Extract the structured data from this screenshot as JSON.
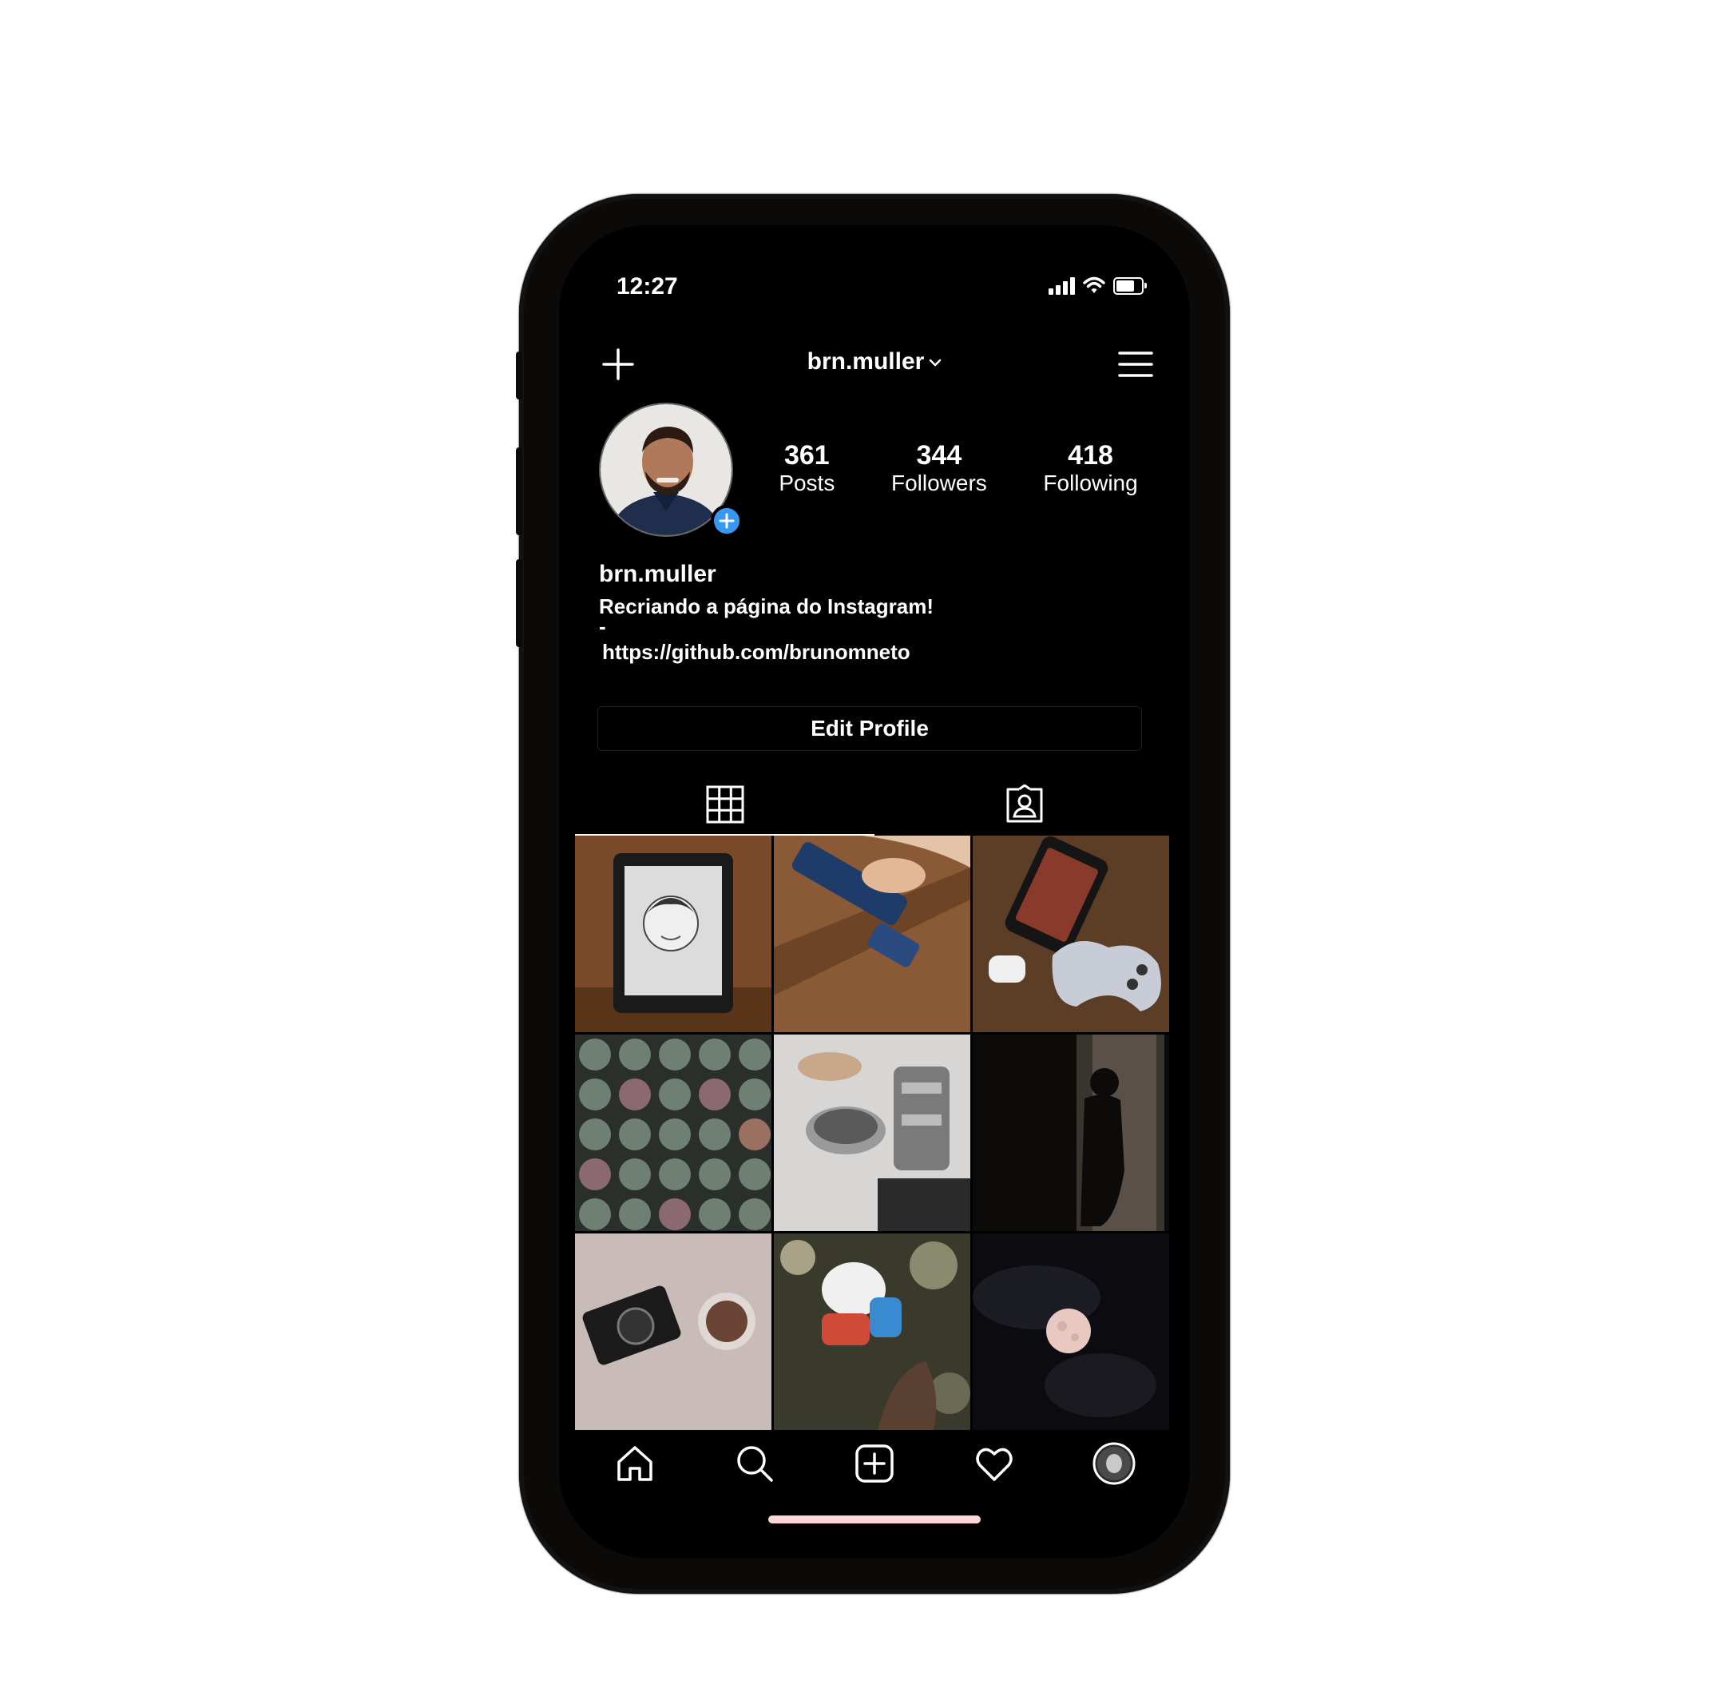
{
  "status_bar": {
    "time": "12:27",
    "icons": [
      "signal-icon",
      "wifi-icon",
      "battery-icon"
    ]
  },
  "header": {
    "username": "brn.muller",
    "left_icon": "plus-icon",
    "right_icon": "menu-icon",
    "dropdown_icon": "chevron-down-icon"
  },
  "profile": {
    "stats": [
      {
        "value": "361",
        "label": "Posts"
      },
      {
        "value": "344",
        "label": "Followers"
      },
      {
        "value": "418",
        "label": "Following"
      }
    ],
    "name": "brn.muller",
    "bio_line": "Recriando a página do Instagram!",
    "bio_dash": "-",
    "link": "https://github.com/brunomneto",
    "edit_button": "Edit Profile",
    "add_story_color": "#3897f0"
  },
  "tabs": [
    {
      "icon": "grid-icon",
      "active": true
    },
    {
      "icon": "tagged-icon",
      "active": false
    }
  ],
  "posts": [
    {
      "subject": "sketch-drawing-photo"
    },
    {
      "subject": "toy-train-photo"
    },
    {
      "subject": "phone-controller-photo"
    },
    {
      "subject": "succulents-photo"
    },
    {
      "subject": "coffee-grinder-photo"
    },
    {
      "subject": "child-silhouette-photo"
    },
    {
      "subject": "camera-coffee-photo"
    },
    {
      "subject": "toy-figure-photo"
    },
    {
      "subject": "moon-photo"
    }
  ],
  "bottom_nav": [
    "home-icon",
    "search-icon",
    "new-post-icon",
    "heart-icon",
    "profile-avatar-icon"
  ]
}
